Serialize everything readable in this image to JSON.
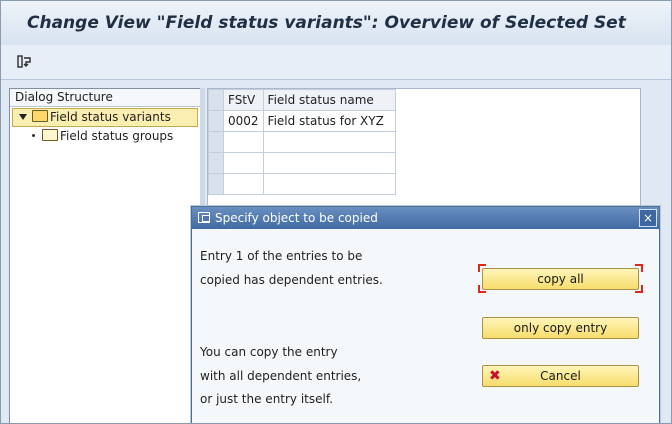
{
  "window": {
    "title": "Change View \"Field status variants\": Overview of Selected Set"
  },
  "toolbar": {
    "icon": "display-change-icon"
  },
  "tree": {
    "header": "Dialog Structure",
    "items": [
      {
        "label": "Field status variants",
        "selected": true
      },
      {
        "label": "Field status groups",
        "selected": false
      }
    ]
  },
  "table": {
    "columns": [
      "FStV",
      "Field status name"
    ],
    "rows": [
      {
        "fstv": "0002",
        "name": "Field status for XYZ"
      }
    ]
  },
  "dialog": {
    "title": "Specify object to be copied",
    "close": "×",
    "message_lines": [
      "Entry  1  of the entries to be",
      "copied has dependent entries.",
      "You can copy the entry",
      "with all dependent entries,",
      "or just the entry itself."
    ],
    "buttons": {
      "copy_all": "copy all",
      "only_copy_entry": "only copy entry",
      "cancel": "Cancel"
    }
  },
  "colors": {
    "accent": "#3f6aa3",
    "button": "#f6dd6c",
    "arrow": "#2f6f6a",
    "focus": "#e0251b"
  }
}
